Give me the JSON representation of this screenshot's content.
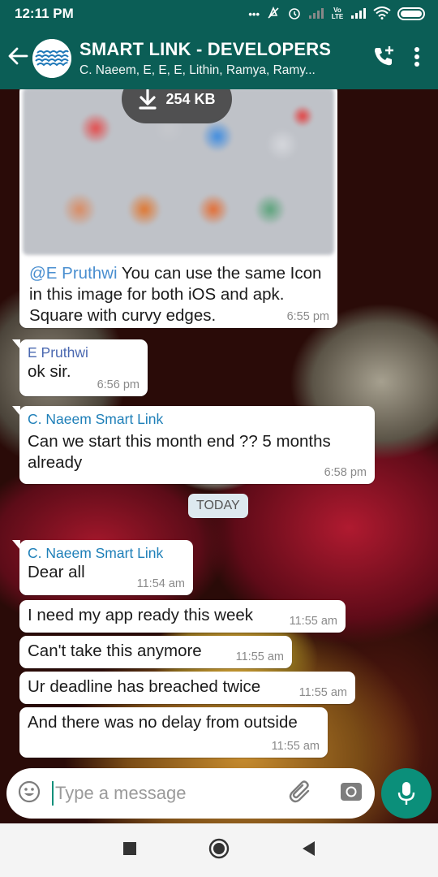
{
  "status_bar": {
    "time": "12:11 PM",
    "dots": "•••",
    "network_label": "Vo LTE"
  },
  "header": {
    "title": "SMART LINK - DEVELOPERS",
    "subtitle": "C. Naeem, E, E, E, Lithin, Ramya, Ramy..."
  },
  "image_message": {
    "file_size": "254 KB",
    "mention": "@E Pruthwi",
    "caption": " You can use the same Icon in this image for both iOS and apk. Square with curvy edges.",
    "time": "6:55 pm"
  },
  "messages": [
    {
      "sender": "E Pruthwi",
      "text": "ok sir.",
      "time": "6:56 pm"
    },
    {
      "sender": "C. Naeem Smart Link",
      "text": "Can we start this month end ?? 5 months already",
      "time": "6:58 pm"
    }
  ],
  "date_separator": "TODAY",
  "today_messages": [
    {
      "sender": "C. Naeem Smart Link",
      "text": "Dear all",
      "time": "11:54 am"
    },
    {
      "text": "I need my app ready this week",
      "time": "11:55 am"
    },
    {
      "text": "Can't take this anymore",
      "time": "11:55 am"
    },
    {
      "text": "Ur deadline has breached twice",
      "time": "11:55 am"
    },
    {
      "text": "And there was no delay from outside",
      "time": "11:55 am"
    }
  ],
  "composer": {
    "placeholder": "Type a message"
  },
  "colors": {
    "header_bg": "#0b5e56",
    "accent": "#0b8f7a",
    "sender_blue": "#1e7fb8"
  }
}
